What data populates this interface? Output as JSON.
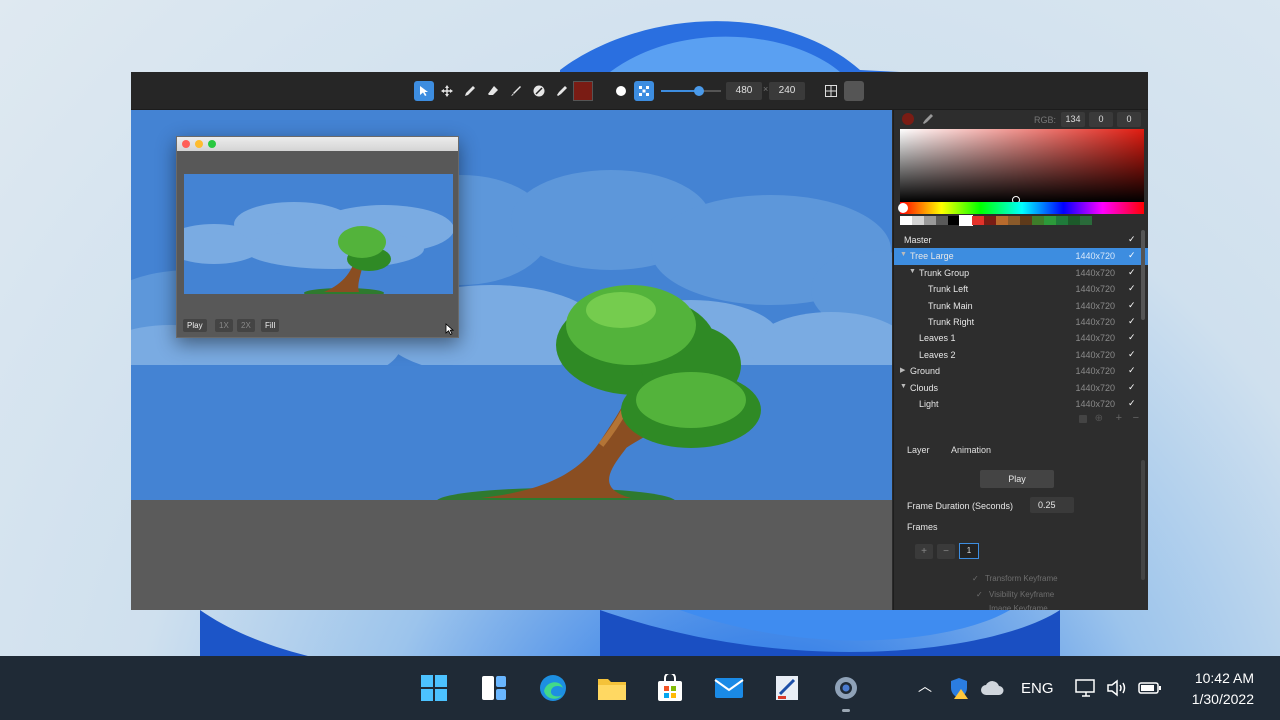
{
  "toolbar": {
    "tools": [
      "pointer-icon",
      "move-icon",
      "pencil-icon",
      "eraser-icon",
      "brush-icon",
      "fill-icon",
      "eyedropper-icon"
    ],
    "active_tool": "pointer-icon",
    "color": "#7a1c14",
    "width": "480",
    "height": "240",
    "brush_size_fraction": 0.62
  },
  "preview": {
    "buttons": [
      "Play",
      "1X",
      "2X",
      "Fill"
    ]
  },
  "color_panel": {
    "rgb_label": "RGB:",
    "r": "134",
    "g": "0",
    "b": "0",
    "swatches": [
      "#ffffff",
      "#d4d4d4",
      "#9a9a9a",
      "#5a5a5a",
      "#000000",
      "#ffffff",
      "#e4322a",
      "#7a1c14",
      "#b86a2c",
      "#8a5a2a",
      "#5e3a1a",
      "#3e7d2a",
      "#2c9a3a",
      "#1f7a3a",
      "#1c5a2a",
      "#2a6a3a"
    ]
  },
  "layers": {
    "master": "Master",
    "items": [
      {
        "name": "Tree Large",
        "size": "1440x720",
        "level": 0,
        "tri": "▼",
        "selected": true
      },
      {
        "name": "Trunk Group",
        "size": "1440x720",
        "level": 1,
        "tri": "▼",
        "selected": false
      },
      {
        "name": "Trunk Left",
        "size": "1440x720",
        "level": 2,
        "tri": "",
        "selected": false
      },
      {
        "name": "Trunk Main",
        "size": "1440x720",
        "level": 2,
        "tri": "",
        "selected": false
      },
      {
        "name": "Trunk Right",
        "size": "1440x720",
        "level": 2,
        "tri": "",
        "selected": false
      },
      {
        "name": "Leaves 1",
        "size": "1440x720",
        "level": 1,
        "tri": "",
        "selected": false
      },
      {
        "name": "Leaves 2",
        "size": "1440x720",
        "level": 1,
        "tri": "",
        "selected": false
      },
      {
        "name": "Ground",
        "size": "1440x720",
        "level": 0,
        "tri": "▶",
        "selected": false
      },
      {
        "name": "Clouds",
        "size": "1440x720",
        "level": 0,
        "tri": "▼",
        "selected": false
      },
      {
        "name": "Light",
        "size": "1440x720",
        "level": 1,
        "tri": "",
        "selected": false
      }
    ]
  },
  "animation": {
    "tab_layer": "Layer",
    "tab_animation": "Animation",
    "play": "Play",
    "frame_duration_label": "Frame Duration (Seconds)",
    "frame_duration": "0.25",
    "frames_label": "Frames",
    "frame_current": "1",
    "transform_keyframe": "Transform Keyframe",
    "visibility_keyframe": "Visibility Keyframe",
    "image_keyframe": "Image Keyframe"
  },
  "taskbar": {
    "apps": [
      "start-icon",
      "widgets-icon",
      "edge-icon",
      "file-explorer-icon",
      "store-icon",
      "mail-icon",
      "paint-icon",
      "settings-icon"
    ],
    "lang": "ENG",
    "time": "10:42 AM",
    "date": "1/30/2022"
  }
}
